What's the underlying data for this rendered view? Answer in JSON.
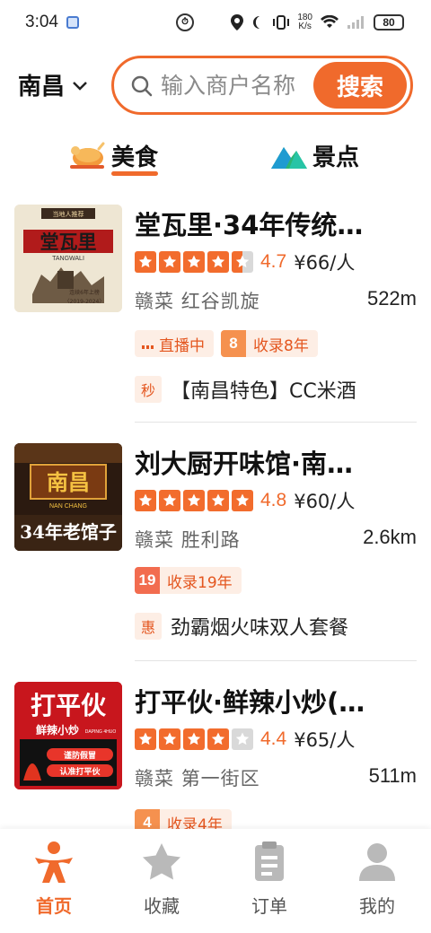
{
  "status_bar": {
    "time": "3:04",
    "speed_value": "180",
    "speed_unit": "K/s",
    "battery": "80"
  },
  "header": {
    "city": "南昌",
    "search_placeholder": "输入商户名称",
    "search_button": "搜索"
  },
  "tabs": [
    {
      "label": "美食",
      "icon": "roast-chicken-icon",
      "active": true
    },
    {
      "label": "景点",
      "icon": "mountain-icon",
      "active": false
    }
  ],
  "colors": {
    "accent": "#f06a2c",
    "star_filled": "#f26c2d",
    "star_empty": "#d9d9d9",
    "tag_bg": "#fdeee5"
  },
  "listings": [
    {
      "title": "堂瓦里·34年传统…",
      "stars": 4.5,
      "score": "4.7",
      "price": "¥66/人",
      "cuisine": "赣菜",
      "area": "红谷凯旋",
      "distance": "522m",
      "live_tag": "直播中",
      "years_badge": "8",
      "years_text": "收录8年",
      "deal_badge": "秒",
      "deal_text": "【南昌特色】CC米酒",
      "thumb": {
        "top_text": "当地人推荐",
        "name": "堂瓦里",
        "pinyin": "TANGWALI",
        "line": "连续6年上榜",
        "years": "〈2019-2024〉"
      }
    },
    {
      "title": "刘大厨开味馆·南…",
      "stars": 5,
      "score": "4.8",
      "price": "¥60/人",
      "cuisine": "赣菜",
      "area": "胜利路",
      "distance": "2.6km",
      "years_badge": "19",
      "years_text": "收录19年",
      "deal_badge": "惠",
      "deal_text": "劲霸烟火味双人套餐",
      "thumb": {
        "name": "南昌",
        "pinyin": "NAN CHANG",
        "slogan": "34年老馆子"
      }
    },
    {
      "title": "打平伙·鲜辣小炒(…",
      "stars": 4,
      "score": "4.4",
      "price": "¥65/人",
      "cuisine": "赣菜",
      "area": "第一街区",
      "distance": "511m",
      "years_badge": "4",
      "years_text": "收录4年",
      "thumb": {
        "name": "打平伙",
        "sub": "鲜辣小炒",
        "pinyin": "DAPING 4HUO",
        "slogan1": "谨防假冒",
        "slogan2": "认准打平伙"
      }
    }
  ],
  "bottom_nav": [
    {
      "label": "首页",
      "icon": "home-person-icon",
      "active": true
    },
    {
      "label": "收藏",
      "icon": "star-icon",
      "active": false
    },
    {
      "label": "订单",
      "icon": "clipboard-icon",
      "active": false
    },
    {
      "label": "我的",
      "icon": "user-icon",
      "active": false
    }
  ]
}
